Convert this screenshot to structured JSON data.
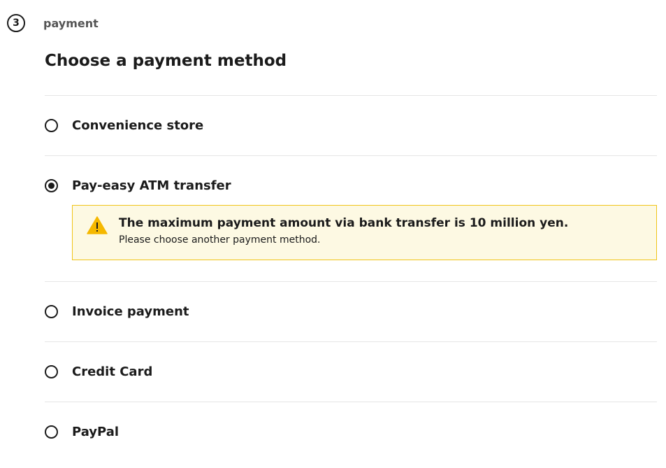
{
  "step": {
    "number": "3",
    "label": "payment"
  },
  "section": {
    "title": "Choose a payment method"
  },
  "payment_methods": [
    {
      "label": "Convenience store",
      "selected": false
    },
    {
      "label": "Pay-easy ATM transfer",
      "selected": true
    },
    {
      "label": "Invoice payment",
      "selected": false
    },
    {
      "label": "Credit Card",
      "selected": false
    },
    {
      "label": "PayPal",
      "selected": false
    }
  ],
  "alert": {
    "icon": "warning-icon",
    "title": "The maximum payment amount via bank transfer is 10 million yen.",
    "body": "Please choose another payment method."
  },
  "colors": {
    "alert_background": "#fdf9e3",
    "alert_border": "#f0c419",
    "warning_icon": "#f5b800",
    "text": "#1b1b1b",
    "divider": "#e6e6e6"
  }
}
